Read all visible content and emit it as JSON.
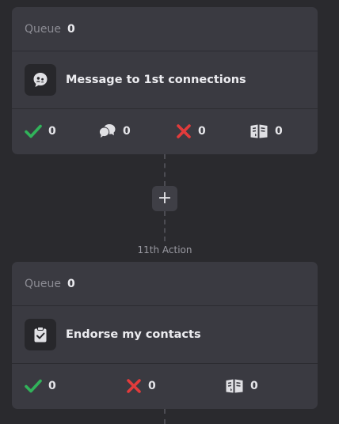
{
  "steps": [
    {
      "queue_label": "Queue",
      "queue_count": "0",
      "action_icon": "message-bubble-icon",
      "action_label": "Message to 1st connections",
      "stats": {
        "success": "0",
        "replied": "0",
        "failed": "0",
        "skipped": "0"
      }
    },
    {
      "queue_label": "Queue",
      "queue_count": "0",
      "action_icon": "clipboard-check-icon",
      "action_label": "Endorse my contacts",
      "stats": {
        "success": "0",
        "failed": "0",
        "skipped": "0"
      }
    }
  ],
  "add_step_symbol": "+",
  "next_step_label": "11th Action",
  "colors": {
    "background": "#2a2a2e",
    "card": "#3a3a41",
    "success": "#31b35a",
    "failed": "#e23b3b",
    "muted": "#8c8c94"
  }
}
